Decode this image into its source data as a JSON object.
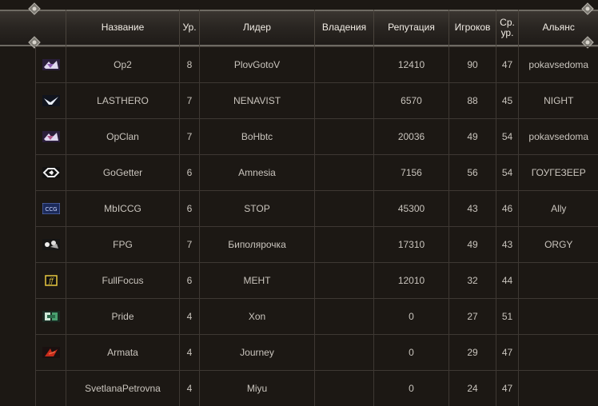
{
  "columns": {
    "name": "Название",
    "level": "Ур.",
    "leader": "Лидер",
    "possessions": "Владения",
    "reputation": "Репутация",
    "players": "Игроков",
    "avg_level_1": "Ср.",
    "avg_level_2": "ур.",
    "alliance": "Альянс"
  },
  "rows": [
    {
      "emblem": "emblem-1",
      "name": "Op2",
      "level": "8",
      "leader": "PlovGotoV",
      "possessions": "",
      "reputation": "12410",
      "players": "90",
      "avg": "47",
      "alliance": "pokavsedoma"
    },
    {
      "emblem": "emblem-2",
      "name": "LASTHERO",
      "level": "7",
      "leader": "NENAVIST",
      "possessions": "",
      "reputation": "6570",
      "players": "88",
      "avg": "45",
      "alliance": "NIGHT"
    },
    {
      "emblem": "emblem-3",
      "name": "OpClan",
      "level": "7",
      "leader": "BoHbtc",
      "possessions": "",
      "reputation": "20036",
      "players": "49",
      "avg": "54",
      "alliance": "pokavsedoma"
    },
    {
      "emblem": "emblem-4",
      "name": "GoGetter",
      "level": "6",
      "leader": "Amnesia",
      "possessions": "",
      "reputation": "7156",
      "players": "56",
      "avg": "54",
      "alliance": "ГОУГЕЗЕЕР"
    },
    {
      "emblem": "emblem-5",
      "name": "MbICCG",
      "level": "6",
      "leader": "STOP",
      "possessions": "",
      "reputation": "45300",
      "players": "43",
      "avg": "46",
      "alliance": "Ally"
    },
    {
      "emblem": "emblem-6",
      "name": "FPG",
      "level": "7",
      "leader": "Биполярочка",
      "possessions": "",
      "reputation": "17310",
      "players": "49",
      "avg": "43",
      "alliance": "ORGY"
    },
    {
      "emblem": "emblem-7",
      "name": "FullFocus",
      "level": "6",
      "leader": "MEHT",
      "possessions": "",
      "reputation": "12010",
      "players": "32",
      "avg": "44",
      "alliance": ""
    },
    {
      "emblem": "emblem-8",
      "name": "Pride",
      "level": "4",
      "leader": "Xon",
      "possessions": "",
      "reputation": "0",
      "players": "27",
      "avg": "51",
      "alliance": ""
    },
    {
      "emblem": "emblem-9",
      "name": "Armata",
      "level": "4",
      "leader": "Journey",
      "possessions": "",
      "reputation": "0",
      "players": "29",
      "avg": "47",
      "alliance": ""
    },
    {
      "emblem": "",
      "name": "SvetlanaPetrovna",
      "level": "4",
      "leader": "Miyu",
      "possessions": "",
      "reputation": "0",
      "players": "24",
      "avg": "47",
      "alliance": ""
    }
  ]
}
